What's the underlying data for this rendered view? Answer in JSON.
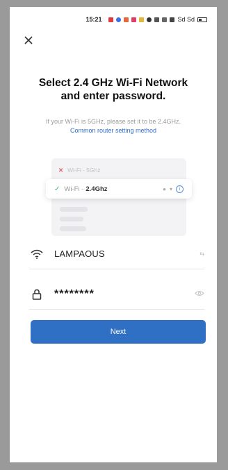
{
  "status_bar": {
    "time": "15:21",
    "network": "Sd Sd"
  },
  "close_icon": "close-icon",
  "title_line1": "Select 2.4 GHz Wi-Fi Network",
  "title_line2": "and enter password.",
  "hint": "If your Wi-Fi is 5GHz, please set it to be 2.4GHz.",
  "router_link": "Common router setting method",
  "illustration": {
    "row_5g_prefix": "Wi-Fi - ",
    "row_5g_band": "5Ghz",
    "row_24_prefix": "Wi-Fi - ",
    "row_24_band": "2.4Ghz"
  },
  "wifi_field": {
    "value": "LAMPAOUS",
    "right_label": "⇆"
  },
  "password_field": {
    "value": "********"
  },
  "next_button": "Next",
  "colors": {
    "accent": "#2f6fc4",
    "link": "#2f6fcf",
    "check": "#3bb56e",
    "cross": "#e06060"
  }
}
